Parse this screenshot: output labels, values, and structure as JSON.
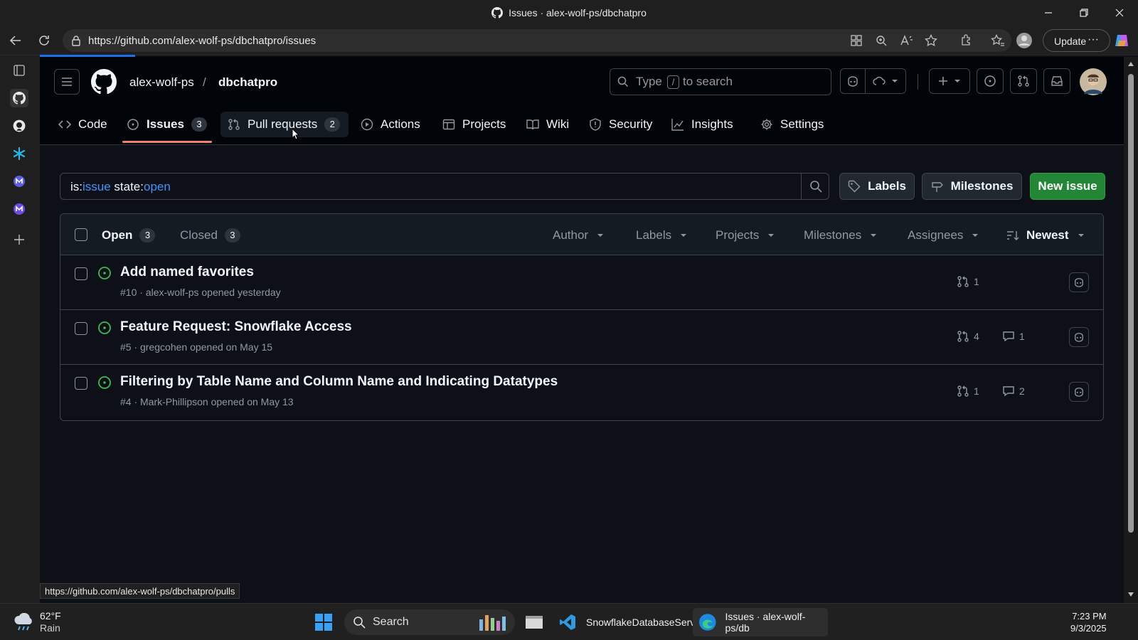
{
  "window": {
    "title": "Issues · alex-wolf-ps/dbchatpro"
  },
  "browser": {
    "url": "https://github.com/alex-wolf-ps/dbchatpro/issues",
    "update_label": "Update",
    "status_url": "https://github.com/alex-wolf-ps/dbchatpro/pulls"
  },
  "repo": {
    "owner": "alex-wolf-ps",
    "separator": "/",
    "name": "dbchatpro"
  },
  "search": {
    "prefix": "Type",
    "key": "/",
    "suffix": "to search"
  },
  "tabs": [
    {
      "label": "Code"
    },
    {
      "label": "Issues",
      "count": "3"
    },
    {
      "label": "Pull requests",
      "count": "2"
    },
    {
      "label": "Actions"
    },
    {
      "label": "Projects"
    },
    {
      "label": "Wiki"
    },
    {
      "label": "Security"
    },
    {
      "label": "Insights"
    },
    {
      "label": "Settings"
    }
  ],
  "filter": {
    "is_key": "is:",
    "is_val": "issue",
    "state_key": " state:",
    "state_val": "open"
  },
  "buttons": {
    "labels": "Labels",
    "milestones": "Milestones",
    "new_issue": "New issue"
  },
  "issues_header": {
    "open_label": "Open",
    "open_count": "3",
    "closed_label": "Closed",
    "closed_count": "3",
    "filters": [
      "Author",
      "Labels",
      "Projects",
      "Milestones",
      "Assignees"
    ],
    "sort": "Newest"
  },
  "issues": [
    {
      "title": "Add named favorites",
      "meta": "#10 · alex-wolf-ps opened yesterday",
      "prs": "1",
      "comments": ""
    },
    {
      "title": "Feature Request: Snowflake Access",
      "meta": "#5 · gregcohen opened on May 15",
      "prs": "4",
      "comments": "1"
    },
    {
      "title": "Filtering by Table Name and Column Name and Indicating Datatypes",
      "meta": "#4 · Mark-Phillipson opened on May 13",
      "prs": "1",
      "comments": "2"
    }
  ],
  "taskbar": {
    "weather_temp": "62°F",
    "weather_desc": "Rain",
    "search_label": "Search",
    "app_vscode": "SnowflakeDatabaseServ",
    "app_edge": "Issues · alex-wolf-ps/db",
    "time": "7:23 PM",
    "date": "9/3/2025"
  },
  "colors": {
    "accent_blue": "#4493f8",
    "open_green": "#3fb950",
    "new_issue_green": "#238636",
    "tab_underline": "#f78166"
  }
}
